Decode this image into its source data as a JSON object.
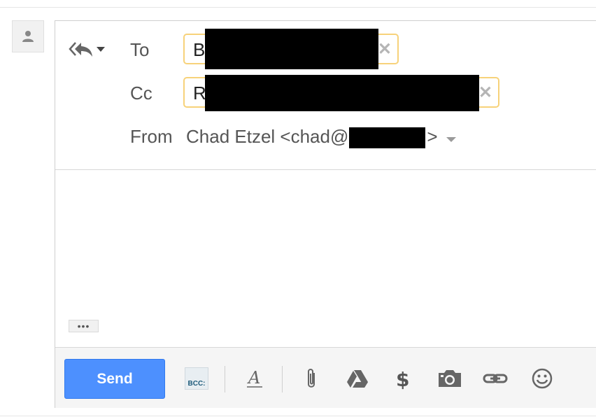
{
  "compose": {
    "reply_icon": "reply-all-icon",
    "to": {
      "label": "To",
      "chip_text": "B"
    },
    "cc": {
      "label": "Cc",
      "chip_text": "R"
    },
    "from": {
      "label": "From",
      "value_prefix": "Chad Etzel <chad@",
      "value_suffix": ">"
    },
    "more_label": "•••"
  },
  "toolbar": {
    "send_label": "Send",
    "bcc_label": "BCC:",
    "icons": [
      "format-text-icon",
      "attach-icon",
      "drive-icon",
      "money-icon",
      "camera-icon",
      "link-icon",
      "emoji-icon"
    ]
  },
  "colors": {
    "send": "#4d90fe",
    "chip_border": "#f7d27a",
    "toolbar_bg": "#f5f5f5"
  }
}
